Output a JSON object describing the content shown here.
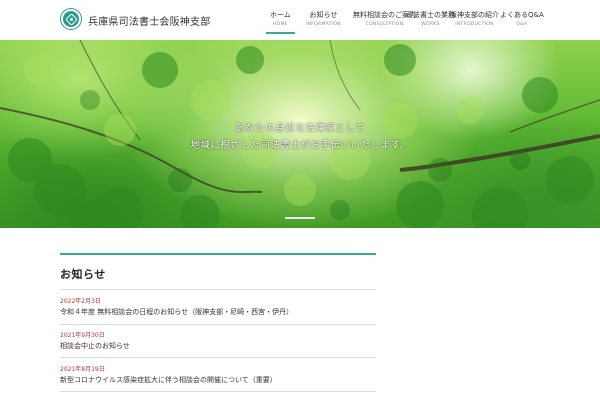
{
  "site": {
    "title": "兵庫県司法書士会阪神支部"
  },
  "nav": {
    "items": [
      {
        "jp": "ホーム",
        "en": "HOME",
        "active": true
      },
      {
        "jp": "お知らせ",
        "en": "INFORMATION",
        "active": false
      },
      {
        "jp": "無料相談会のご案内",
        "en": "CONSULTATION",
        "active": false
      },
      {
        "jp": "司法書士の業務",
        "en": "WORKS",
        "active": false
      },
      {
        "jp": "阪神支部の紹介",
        "en": "INTRODUCTION",
        "active": false
      },
      {
        "jp": "よくあるQ&A",
        "en": "Q&A",
        "active": false
      }
    ]
  },
  "hero": {
    "line1": "あなたの身近な法律家として",
    "line2": "地域に根ざした司法書士がお手伝いいたします。",
    "slide_count": 1
  },
  "news": {
    "heading": "お知らせ",
    "items": [
      {
        "date": "2022年2月3日",
        "text": "令和４年度 無料相談会の日程のお知らせ（阪神支部・尼崎・西宮・伊丹）"
      },
      {
        "date": "2021年9月30日",
        "text": "相談会中止のお知らせ"
      },
      {
        "date": "2021年8月19日",
        "text": "新型コロナウイルス感染症拡大に伴う相談会の開催について（重要）"
      }
    ]
  },
  "colors": {
    "accent": "#3aa89a",
    "date": "#b03a3a",
    "logo": "#2a9a8c"
  }
}
